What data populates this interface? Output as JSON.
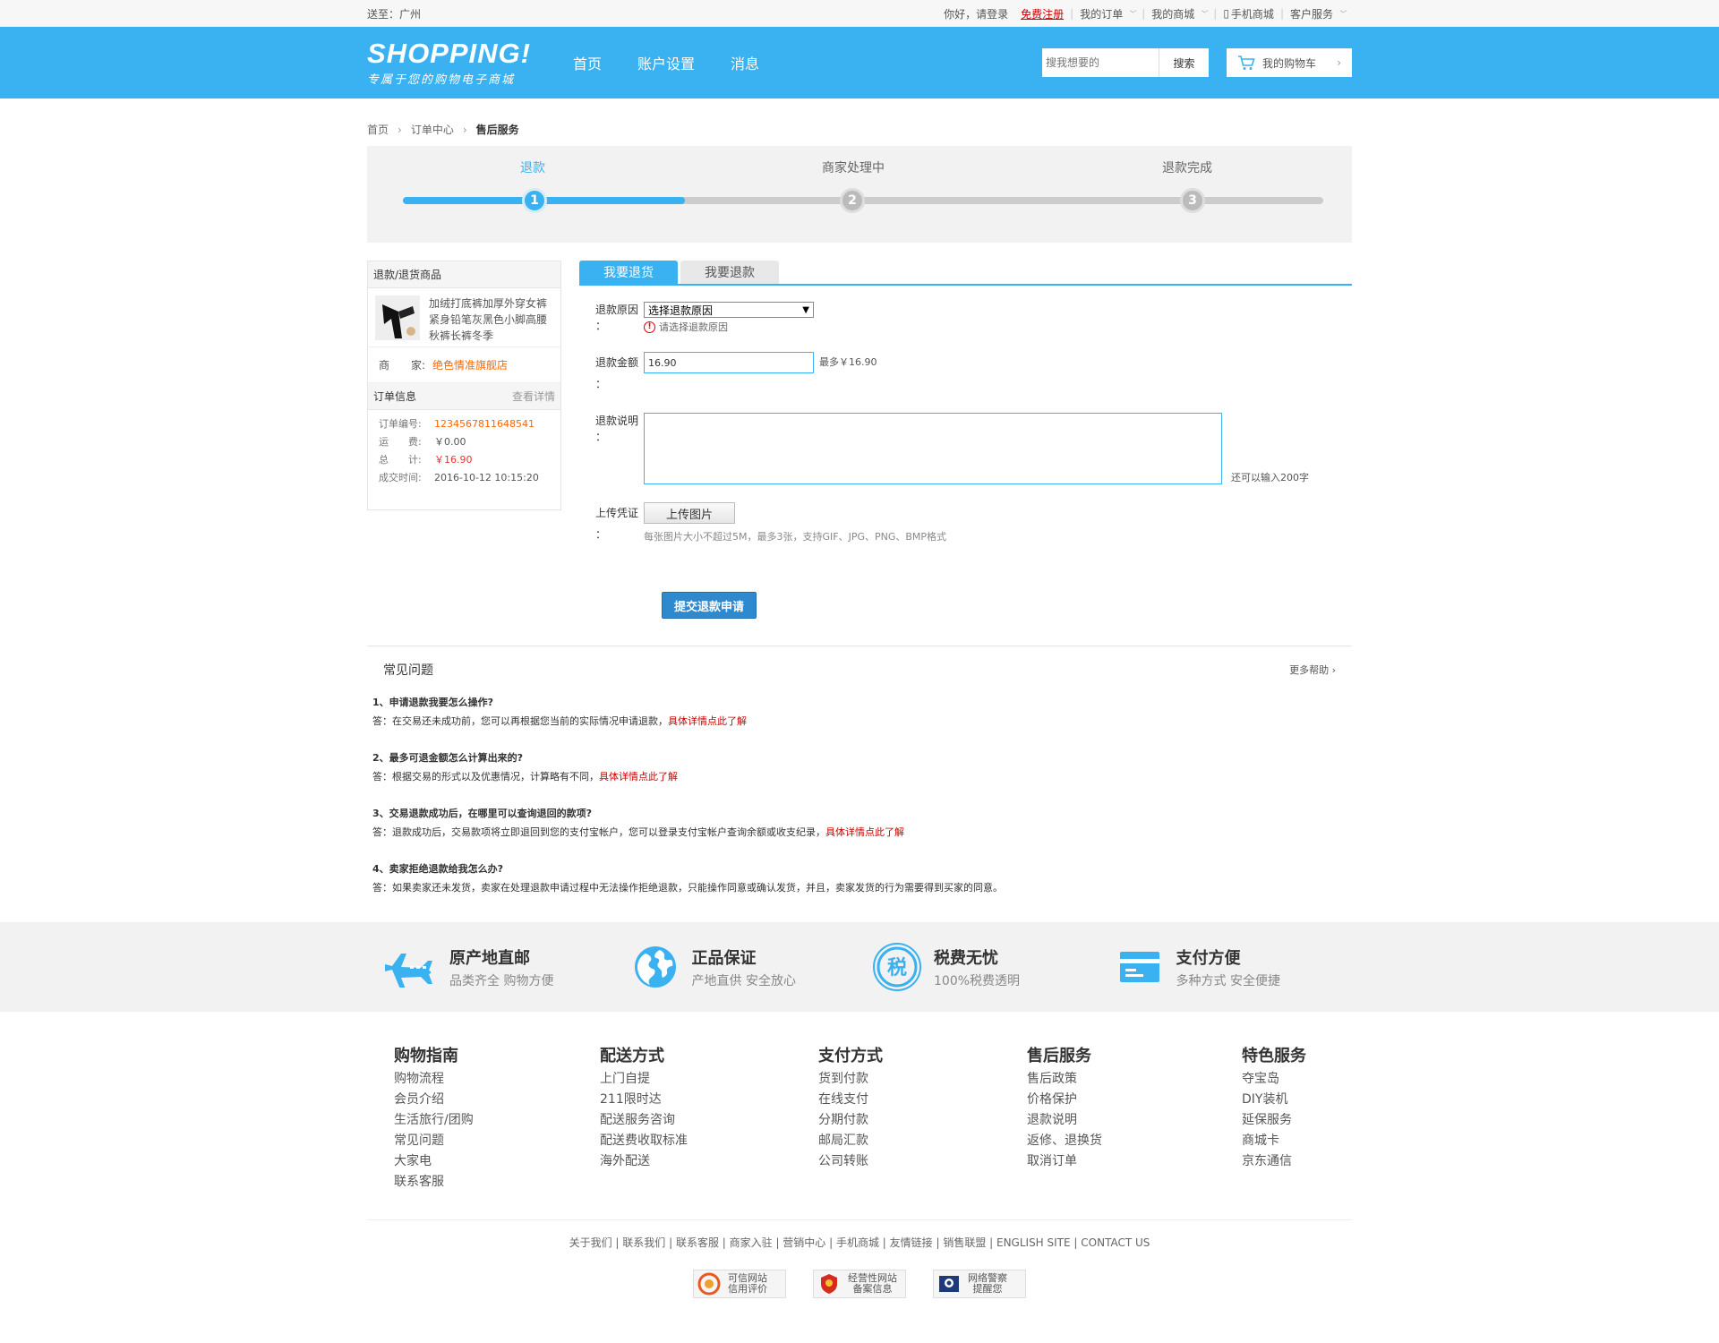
{
  "topbar": {
    "ship_to": "送至：广州",
    "greeting": "你好，请登录",
    "register": "免费注册",
    "my_orders": "我的订单",
    "my_mall": "我的商城",
    "mobile_mall": "手机商城",
    "customer_service": "客户服务"
  },
  "header": {
    "logo": "SHOPPING!",
    "slogan": "专属于您的购物电子商城",
    "nav": [
      "首页",
      "账户设置",
      "消息"
    ],
    "search_placeholder": "搜我想要的",
    "search_button": "搜索",
    "cart": "我的购物车"
  },
  "breadcrumb": [
    "首页",
    "订单中心",
    "售后服务"
  ],
  "steps": [
    {
      "num": "1",
      "label": "退款"
    },
    {
      "num": "2",
      "label": "商家处理中"
    },
    {
      "num": "3",
      "label": "退款完成"
    }
  ],
  "sidebar": {
    "title": "退款/退货商品",
    "product": "加绒打底裤加厚外穿女裤紧身铅笔灰黑色小脚高腰秋裤长裤冬季",
    "seller_label": "商　　家:",
    "seller": "绝色情准旗舰店",
    "order_title": "订单信息",
    "order_more": "查看详情",
    "order_no_label": "订单编号:",
    "order_no": "1234567811648541",
    "freight_label": "运　　费:",
    "freight": "￥0.00",
    "total_label": "总　　计:",
    "total": "￥16.90",
    "time_label": "成交时间:",
    "time": "2016-10-12 10:15:20"
  },
  "form": {
    "tabs": [
      "我要退货",
      "我要退款"
    ],
    "reason_label": "退款原因 ：",
    "reason_value": "选择退款原因",
    "reason_error": "请选择退款原因",
    "amount_label": "退款金额 ：",
    "amount_value": "16.90",
    "amount_max": "最多￥16.90",
    "desc_label": "退款说明 ：",
    "desc_remain": "还可以输入200字",
    "upload_label": "上传凭证 ：",
    "upload_button": "上传图片",
    "upload_hint": "每张图片大小不超过5M，最多3张，支持GIF、JPG、PNG、BMP格式",
    "submit": "提交退款申请"
  },
  "faq": {
    "title": "常见问题",
    "more": "更多帮助",
    "items": [
      {
        "q": "1、申请退款我要怎么操作?",
        "a": "答：在交易还未成功前，您可以再根据您当前的实际情况申请退款，",
        "link": "具体详情点此了解"
      },
      {
        "q": "2、最多可退金额怎么计算出来的?",
        "a": "答：根据交易的形式以及优惠情况，计算略有不同，",
        "link": "具体详情点此了解"
      },
      {
        "q": "3、交易退款成功后，在哪里可以查询退回的款项?",
        "a": "答：退款成功后，交易款项将立即退回到您的支付宝帐户，您可以登录支付宝帐户查询余额或收支纪录，",
        "link": "具体详情点此了解"
      },
      {
        "q": "4、卖家拒绝退款给我怎么办?",
        "a": "答：如果卖家还未发货，卖家在处理退款申请过程中无法操作拒绝退款，只能操作同意或确认发货，并且，卖家发货的行为需要得到买家的同意。",
        "link": ""
      }
    ]
  },
  "features": [
    {
      "icon": "airplane-icon",
      "title": "原产地直邮",
      "sub": "品类齐全 购物方便"
    },
    {
      "icon": "globe-icon",
      "title": "正品保证",
      "sub": "产地直供 安全放心"
    },
    {
      "icon": "tax-icon",
      "title": "税费无忧",
      "sub": "100%税费透明"
    },
    {
      "icon": "card-icon",
      "title": "支付方便",
      "sub": "多种方式 安全便捷"
    }
  ],
  "footer_cols": [
    {
      "title": "购物指南",
      "items": [
        "购物流程",
        "会员介绍",
        "生活旅行/团购",
        "常见问题",
        "大家电",
        "联系客服"
      ]
    },
    {
      "title": "配送方式",
      "items": [
        "上门自提",
        "211限时达",
        "配送服务咨询",
        "配送费收取标准",
        "海外配送"
      ]
    },
    {
      "title": "支付方式",
      "items": [
        "货到付款",
        "在线支付",
        "分期付款",
        "邮局汇款",
        "公司转账"
      ]
    },
    {
      "title": "售后服务",
      "items": [
        "售后政策",
        "价格保护",
        "退款说明",
        "返修、退换货",
        "取消订单"
      ]
    },
    {
      "title": "特色服务",
      "items": [
        "夺宝岛",
        "DIY装机",
        "延保服务",
        "商城卡",
        "京东通信"
      ]
    }
  ],
  "bottom_links": "关于我们 | 联系我们 | 联系客服 | 商家入驻 | 营销中心 | 手机商城 | 友情链接 | 销售联盟 | ENGLISH SITE | CONTACT US",
  "badges": [
    {
      "l1": "可信网站",
      "l2": "信用评价"
    },
    {
      "l1": "经营性网站",
      "l2": "备案信息"
    },
    {
      "l1": "网络警察",
      "l2": "提醒您"
    }
  ],
  "colors": {
    "brand": "#3ab1f0",
    "submit": "#2f89cf",
    "link_red": "#cc0000",
    "orange": "#ff6600"
  }
}
